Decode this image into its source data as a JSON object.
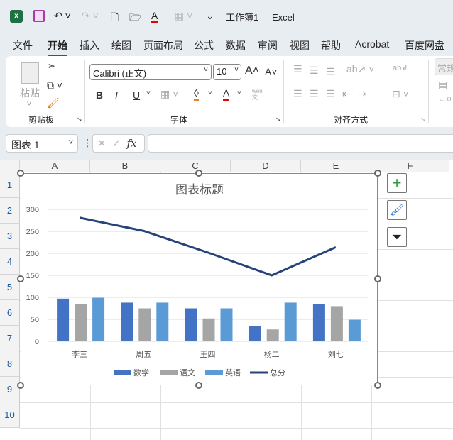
{
  "titlebar": {
    "title": "工作簿1  -  Excel"
  },
  "tabs": [
    "文件",
    "开始",
    "插入",
    "绘图",
    "页面布局",
    "公式",
    "数据",
    "审阅",
    "视图",
    "帮助",
    "Acrobat",
    "百度网盘"
  ],
  "ribbon": {
    "paste": "粘贴",
    "clipboard": "剪贴板",
    "font_name": "Calibri (正文)",
    "font_size": "10",
    "font": "字体",
    "alignment": "对齐方式",
    "number_format": "常规",
    "bold": "B",
    "italic": "I",
    "underline": "U",
    "font_color": "A",
    "grow": "A",
    "shrink": "A",
    "wen": "wén 文"
  },
  "formula": {
    "name_box": "图表 1",
    "fx": "fx",
    "value": ""
  },
  "columns": [
    "A",
    "B",
    "C",
    "D",
    "E",
    "F"
  ],
  "rows": [
    "1",
    "2",
    "3",
    "4",
    "5",
    "6",
    "7",
    "8",
    "9",
    "10"
  ],
  "colors": {
    "math": "#4472c4",
    "chinese": "#a5a5a5",
    "english": "#5b9bd5",
    "total": "#264478"
  },
  "chart_data": {
    "type": "bar",
    "title": "图表标题",
    "categories": [
      "李三",
      "周五",
      "王四",
      "杨二",
      "刘七"
    ],
    "series": [
      {
        "name": "数学",
        "type": "bar",
        "values": [
          97,
          88,
          75,
          35,
          85
        ]
      },
      {
        "name": "语文",
        "type": "bar",
        "values": [
          85,
          75,
          52,
          27,
          80
        ]
      },
      {
        "name": "英语",
        "type": "bar",
        "values": [
          99,
          88,
          75,
          88,
          49
        ]
      },
      {
        "name": "总分",
        "type": "line",
        "values": [
          281,
          251,
          202,
          150,
          214
        ]
      }
    ],
    "ylim": [
      0,
      300
    ],
    "yticks": [
      0,
      50,
      100,
      150,
      200,
      250,
      300
    ],
    "grid": true,
    "legend": "bottom",
    "xlabel": "",
    "ylabel": ""
  }
}
